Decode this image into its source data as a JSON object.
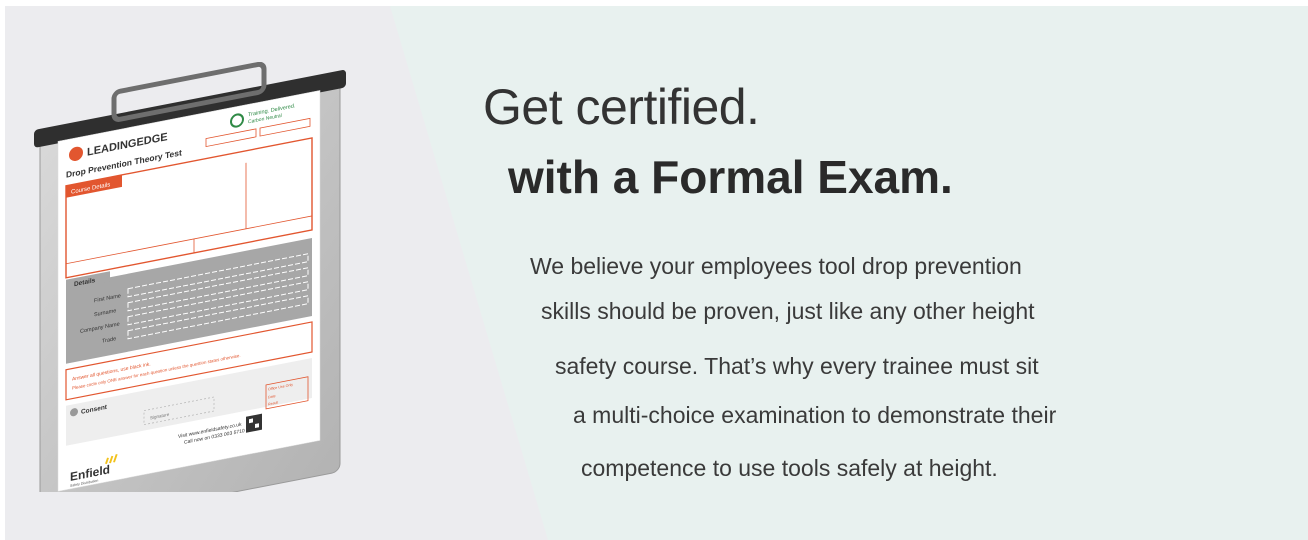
{
  "headline": "Get certified.",
  "subhead": "with a Formal Exam.",
  "body_lines": [
    "We believe your employees tool drop prevention",
    "skills should be proven, just like any other height",
    "safety course. That’s why every trainee must sit",
    "a multi-choice examination to demonstrate their",
    "competence to use tools safely at height."
  ],
  "clipboard": {
    "logo": "LEADINGEDGE",
    "tagline": "Training. Delivered.",
    "carbon": "Carbon Neutral",
    "form_title": "Drop Prevention Theory Test",
    "course_section": "Course Details",
    "details_section": "Details",
    "field_labels": [
      "First Name",
      "Surname",
      "Company Name",
      "Trade"
    ],
    "instructions": [
      "Answer all questions, use black ink.",
      "Please circle only ONE answer for each question unless the question states otherwise."
    ],
    "consent_section": "Consent",
    "signature": "Signature",
    "website_line": "Visit www.enfieldsafety.co.uk",
    "phone_line": "Call now on 0333 003 5710",
    "brand": "Enfield",
    "brand_sub": "Safety Distribution",
    "office_box": [
      "Office Use Only",
      "Date",
      "Result"
    ]
  },
  "colors": {
    "accent": "#e2562f",
    "text_dark": "#333333"
  }
}
